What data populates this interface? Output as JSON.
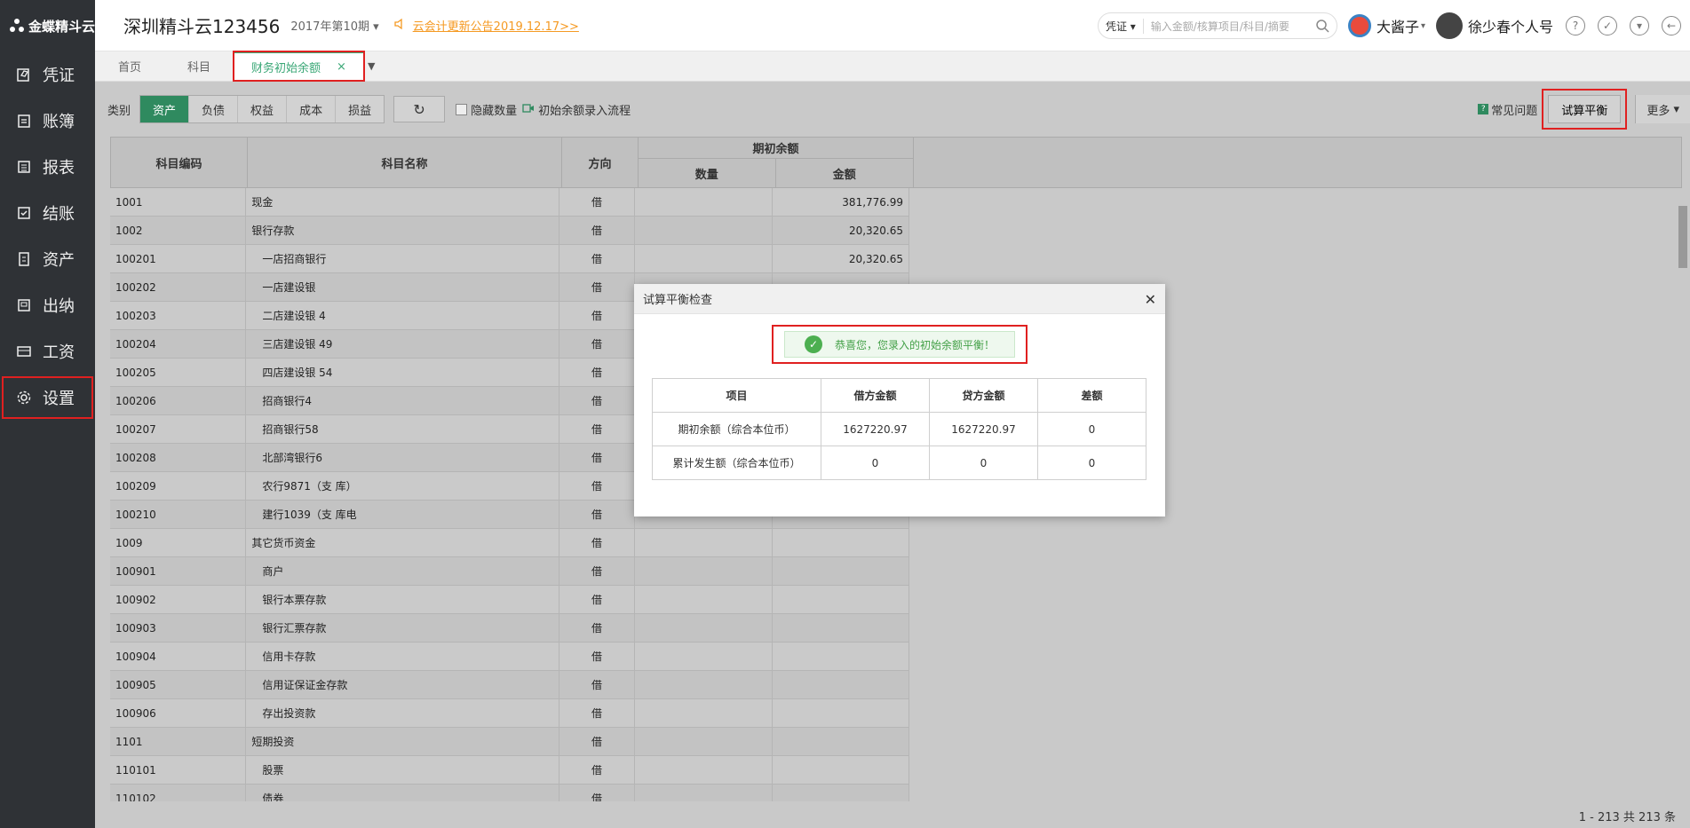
{
  "app": {
    "logo": "金蝶精斗云"
  },
  "sidebar": {
    "items": [
      {
        "label": "凭证",
        "icon": "voucher-icon"
      },
      {
        "label": "账簿",
        "icon": "ledger-icon"
      },
      {
        "label": "报表",
        "icon": "report-icon"
      },
      {
        "label": "结账",
        "icon": "checkout-icon"
      },
      {
        "label": "资产",
        "icon": "asset-icon"
      },
      {
        "label": "出纳",
        "icon": "cashier-icon"
      },
      {
        "label": "工资",
        "icon": "salary-icon"
      },
      {
        "label": "设置",
        "icon": "gear-icon",
        "active": true
      }
    ]
  },
  "header": {
    "company": "深圳精斗云123456",
    "period": "2017年第10期",
    "notice": "云会计更新公告2019.12.17>>",
    "search_type": "凭证",
    "search_placeholder": "输入金额/核算项目/科目/摘要",
    "user1": "大酱子",
    "user2": "徐少春个人号"
  },
  "tabs": [
    {
      "label": "首页"
    },
    {
      "label": "科目"
    },
    {
      "label": "财务初始余额",
      "active": true
    }
  ],
  "toolbar": {
    "category_label": "类别",
    "categories": [
      "资产",
      "负债",
      "权益",
      "成本",
      "损益"
    ],
    "hide_qty": "隐藏数量",
    "flow": "初始余额录入流程",
    "faq": "常见问题",
    "balance": "试算平衡",
    "more": "更多"
  },
  "table": {
    "headers": {
      "code": "科目编码",
      "name": "科目名称",
      "dir": "方向",
      "group": "期初余额",
      "qty": "数量",
      "amount": "金额"
    },
    "rows": [
      {
        "code": "1001",
        "name": "现金",
        "dir": "借",
        "amount": "381,776.99",
        "sub": false
      },
      {
        "code": "1002",
        "name": "银行存款",
        "dir": "借",
        "amount": "20,320.65",
        "sub": false
      },
      {
        "code": "100201",
        "name": "一店招商银行",
        "dir": "借",
        "amount": "20,320.65",
        "sub": true
      },
      {
        "code": "100202",
        "name": "一店建设银",
        "dir": "借",
        "amount": "",
        "sub": true
      },
      {
        "code": "100203",
        "name": "二店建设银 4",
        "dir": "借",
        "amount": "",
        "sub": true
      },
      {
        "code": "100204",
        "name": "三店建设银 49",
        "dir": "借",
        "amount": "",
        "sub": true
      },
      {
        "code": "100205",
        "name": "四店建设银 54",
        "dir": "借",
        "amount": "",
        "sub": true
      },
      {
        "code": "100206",
        "name": "招商银行4",
        "dir": "借",
        "amount": "",
        "sub": true
      },
      {
        "code": "100207",
        "name": "招商银行58",
        "dir": "借",
        "amount": "",
        "sub": true
      },
      {
        "code": "100208",
        "name": "北部湾银行6",
        "dir": "借",
        "amount": "",
        "sub": true
      },
      {
        "code": "100209",
        "name": "农行9871（支 库）",
        "dir": "借",
        "amount": "",
        "sub": true
      },
      {
        "code": "100210",
        "name": "建行1039（支 库电",
        "dir": "借",
        "amount": "",
        "sub": true
      },
      {
        "code": "1009",
        "name": "其它货币资金",
        "dir": "借",
        "amount": "",
        "sub": false
      },
      {
        "code": "100901",
        "name": "商户",
        "dir": "借",
        "amount": "",
        "sub": true
      },
      {
        "code": "100902",
        "name": "银行本票存款",
        "dir": "借",
        "amount": "",
        "sub": true
      },
      {
        "code": "100903",
        "name": "银行汇票存款",
        "dir": "借",
        "amount": "",
        "sub": true
      },
      {
        "code": "100904",
        "name": "信用卡存款",
        "dir": "借",
        "amount": "",
        "sub": true
      },
      {
        "code": "100905",
        "name": "信用证保证金存款",
        "dir": "借",
        "amount": "",
        "sub": true
      },
      {
        "code": "100906",
        "name": "存出投资款",
        "dir": "借",
        "amount": "",
        "sub": true
      },
      {
        "code": "1101",
        "name": "短期投资",
        "dir": "借",
        "amount": "",
        "sub": false
      },
      {
        "code": "110101",
        "name": "股票",
        "dir": "借",
        "amount": "",
        "sub": true
      },
      {
        "code": "110102",
        "name": "债券",
        "dir": "借",
        "amount": "",
        "sub": true
      }
    ]
  },
  "pager": "1 - 213  共 213 条",
  "modal": {
    "title": "试算平衡检查",
    "success": "恭喜您，您录入的初始余额平衡！",
    "headers": [
      "项目",
      "借方金额",
      "贷方金额",
      "差额"
    ],
    "rows": [
      [
        "期初余额（综合本位币）",
        "1627220.97",
        "1627220.97",
        "0"
      ],
      [
        "累计发生额（综合本位币）",
        "0",
        "0",
        "0"
      ]
    ]
  }
}
